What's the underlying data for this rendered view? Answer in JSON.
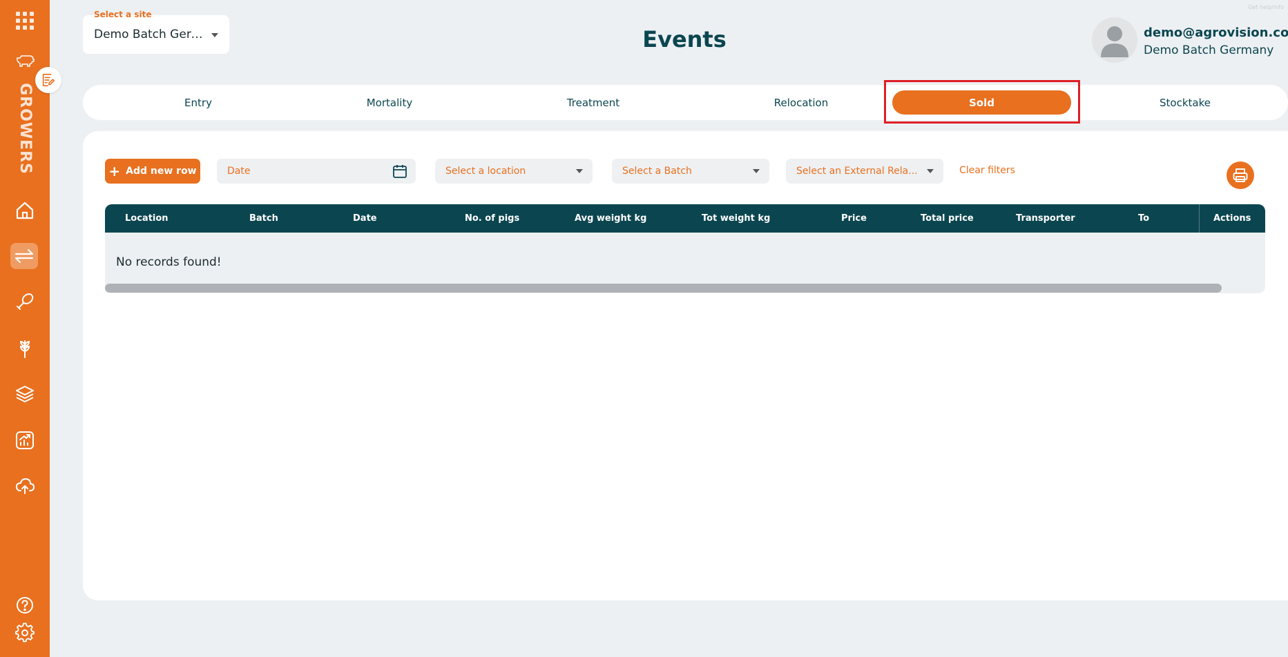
{
  "sidebar": {
    "section_label": "GROWERS",
    "icons": [
      "apps-grid-icon",
      "pig-icon",
      "home-icon",
      "events-arrows-icon",
      "meat-leg-icon",
      "grain-icon",
      "layers-icon",
      "reports-chart-icon",
      "cloud-upload-icon",
      "help-icon",
      "settings-icon"
    ],
    "active": "events-arrows-icon",
    "badge_icon": "notes-edit-icon"
  },
  "site_select": {
    "label": "Select a site",
    "value": "Demo Batch Germany"
  },
  "header": {
    "title": "Events",
    "corner_text": "Get help/info"
  },
  "user": {
    "email": "demo@agrovision.com",
    "site": "Demo Batch Germany"
  },
  "tabs": [
    {
      "label": "Entry"
    },
    {
      "label": "Mortality"
    },
    {
      "label": "Treatment"
    },
    {
      "label": "Relocation"
    },
    {
      "label": "Sold",
      "active": true
    },
    {
      "label": "Stocktake"
    }
  ],
  "filters": {
    "add_label": "Add new row",
    "date_placeholder": "Date",
    "location_placeholder": "Select a location",
    "batch_placeholder": "Select a Batch",
    "external_placeholder": "Select an External Rela...",
    "clear_label": "Clear filters"
  },
  "table": {
    "columns": [
      "Location",
      "Batch",
      "Date",
      "No. of pigs",
      "Avg weight kg",
      "Tot weight kg",
      "Price",
      "Total price",
      "Transporter",
      "To",
      "Actions"
    ],
    "empty_message": "No records found!"
  },
  "colors": {
    "accent": "#e8701f",
    "primary": "#0b4650",
    "background": "#edf0f3",
    "highlight": "#e01e25"
  }
}
